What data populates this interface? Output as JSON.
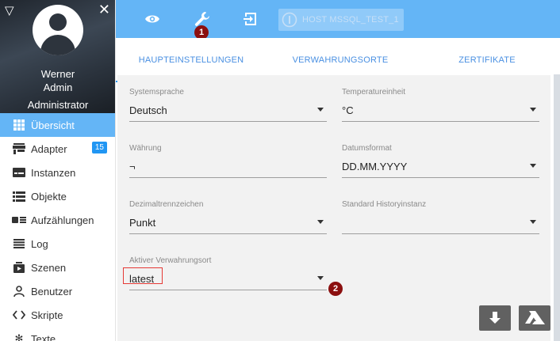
{
  "profile": {
    "first_name": "Werner",
    "username": "Admin",
    "role": "Administrator"
  },
  "sidebar": {
    "items": [
      {
        "label": "Übersicht",
        "icon": "grid-icon",
        "active": true
      },
      {
        "label": "Adapter",
        "icon": "store-icon",
        "badge": "15"
      },
      {
        "label": "Instanzen",
        "icon": "instances-icon"
      },
      {
        "label": "Objekte",
        "icon": "list-icon"
      },
      {
        "label": "Aufzählungen",
        "icon": "enum-icon"
      },
      {
        "label": "Log",
        "icon": "log-icon"
      },
      {
        "label": "Szenen",
        "icon": "scenes-icon"
      },
      {
        "label": "Benutzer",
        "icon": "user-icon"
      },
      {
        "label": "Skripte",
        "icon": "code-icon"
      },
      {
        "label": "Texte",
        "icon": "snowflake-icon"
      }
    ]
  },
  "topbar": {
    "host_label": "HOST MSSQL_TEST_1",
    "marker1": "1",
    "marker2": "2"
  },
  "tabs": [
    {
      "label": "HAUPTEINSTELLUNGEN",
      "active": true
    },
    {
      "label": "VERWAHRUNGSORTE"
    },
    {
      "label": "ZERTIFIKATE"
    }
  ],
  "fields": {
    "language": {
      "label": "Systemsprache",
      "value": "Deutsch"
    },
    "temp_unit": {
      "label": "Temperatureinheit",
      "value": "°C"
    },
    "currency": {
      "label": "Währung",
      "value": "¬"
    },
    "date_format": {
      "label": "Datumsformat",
      "value": "DD.MM.YYYY"
    },
    "decimal_sep": {
      "label": "Dezimaltrennzeichen",
      "value": "Punkt"
    },
    "history": {
      "label": "Standard Historyinstanz",
      "value": ""
    },
    "repository": {
      "label": "Aktiver Verwahrungsort",
      "value": "latest"
    }
  },
  "colors": {
    "accent": "#64b5f6",
    "marker": "#8b0f0f",
    "highlight": "#e53935"
  }
}
